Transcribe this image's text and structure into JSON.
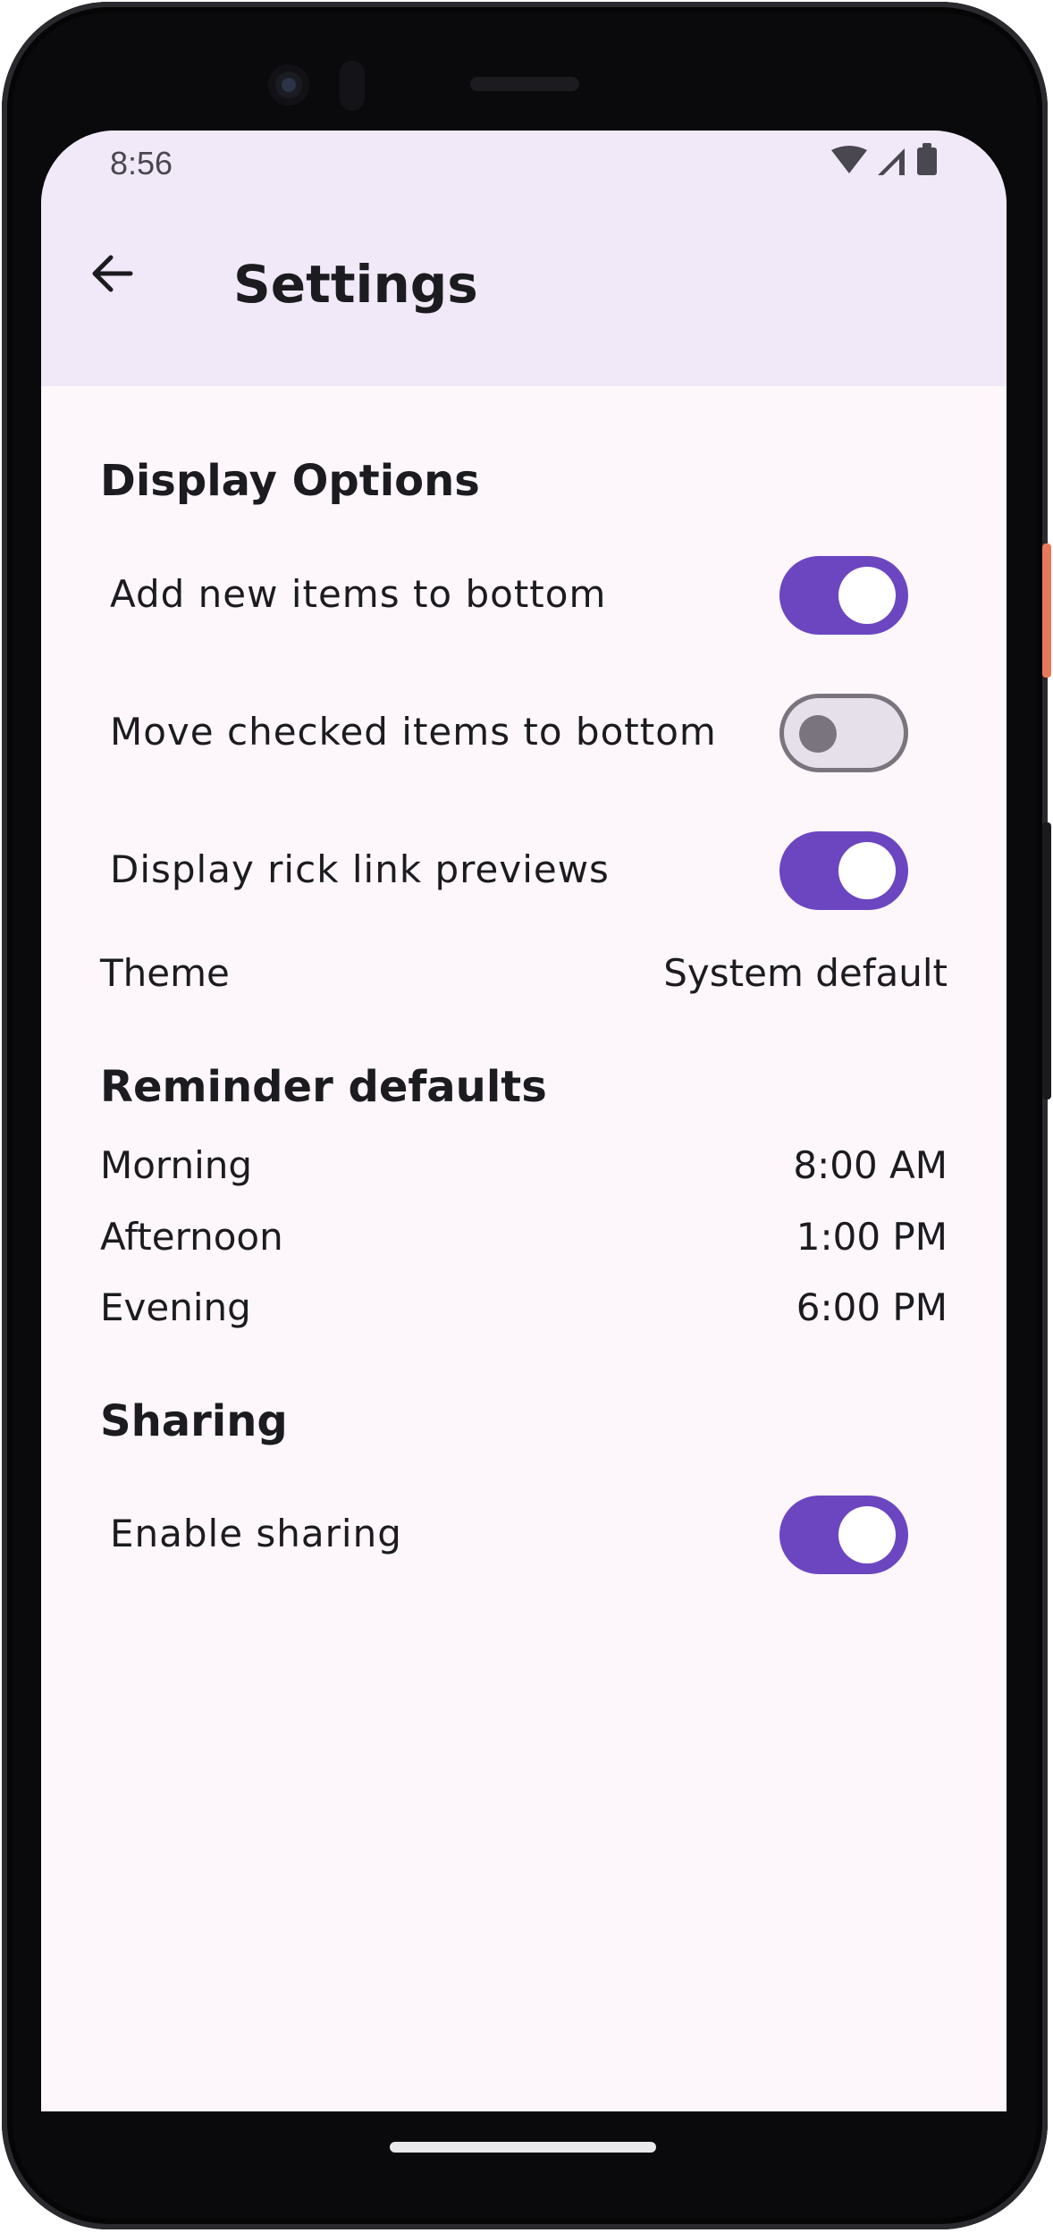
{
  "status_bar": {
    "time": "8:56",
    "icons": [
      "wifi-icon",
      "signal-icon",
      "battery-icon"
    ]
  },
  "app_bar": {
    "title": "Settings",
    "back_icon": "arrow-back-icon"
  },
  "sections": {
    "display": {
      "header": "Display Options",
      "items": [
        {
          "label": "Add new items to bottom",
          "enabled": true
        },
        {
          "label": "Move checked items to bottom",
          "enabled": false
        },
        {
          "label": "Display rick link previews",
          "enabled": true
        }
      ],
      "theme": {
        "label": "Theme",
        "value": "System default"
      }
    },
    "reminders": {
      "header": "Reminder defaults",
      "items": [
        {
          "label": "Morning",
          "value": "8:00 AM"
        },
        {
          "label": "Afternoon",
          "value": "1:00 PM"
        },
        {
          "label": "Evening",
          "value": "6:00 PM"
        }
      ]
    },
    "sharing": {
      "header": "Sharing",
      "items": [
        {
          "label": "Enable sharing",
          "enabled": true
        }
      ]
    }
  },
  "colors": {
    "accent": "#6c46c0",
    "app_bar": "#f1e9f7",
    "surface": "#fdf7fc",
    "switch_off_track": "#e6e0ea",
    "switch_off_outline": "#79747e"
  }
}
